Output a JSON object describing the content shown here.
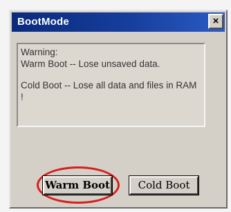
{
  "window": {
    "title": "BootMode",
    "close_label": "×"
  },
  "message": {
    "heading": "Warning:",
    "warm_text": "Warm Boot -- Lose unsaved data.",
    "cold_text": "Cold Boot -- Lose all data and files in RAM !"
  },
  "buttons": {
    "warm_label": "Warm Boot",
    "cold_label": "Cold Boot"
  },
  "annotation": {
    "color": "#d81e1e"
  }
}
